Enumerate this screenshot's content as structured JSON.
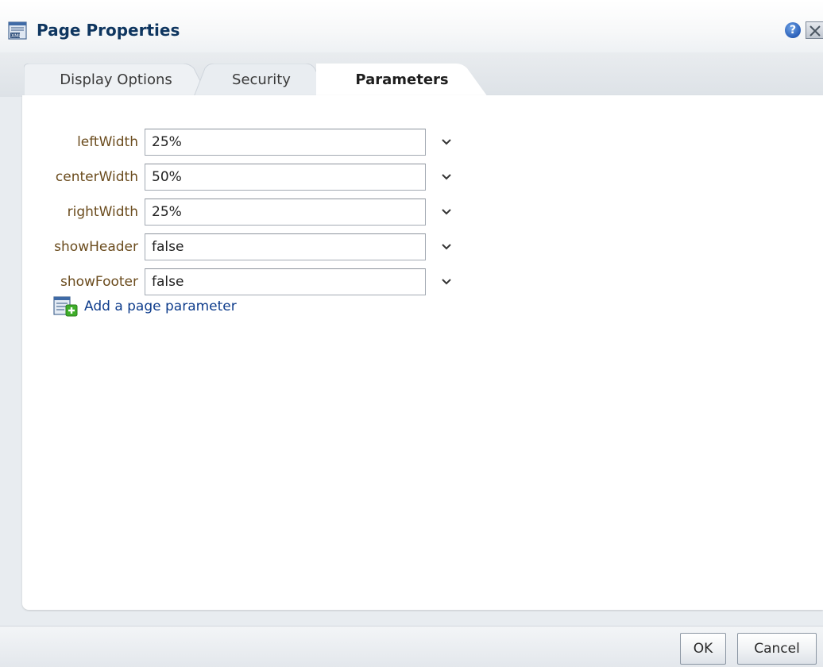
{
  "dialog": {
    "title": "Page Properties",
    "help_symbol": "?",
    "icons": {
      "title": "page-properties-icon",
      "help": "help-icon",
      "close": "close-icon"
    }
  },
  "tabs": [
    {
      "label": "Display Options",
      "active": false
    },
    {
      "label": "Security",
      "active": false
    },
    {
      "label": "Parameters",
      "active": true
    }
  ],
  "parameters": [
    {
      "name": "leftWidth",
      "value": "25%"
    },
    {
      "name": "centerWidth",
      "value": "50%"
    },
    {
      "name": "rightWidth",
      "value": "25%"
    },
    {
      "name": "showHeader",
      "value": "false"
    },
    {
      "name": "showFooter",
      "value": "false"
    }
  ],
  "add_parameter": {
    "label": "Add a page parameter",
    "icon": "add-page-parameter-icon"
  },
  "footer": {
    "ok_label": "OK",
    "cancel_label": "Cancel"
  },
  "colors": {
    "title_text": "#0f3660",
    "param_label": "#6b4c1e",
    "link": "#0f3d8c",
    "dialog_background": "#e8ecf0"
  }
}
